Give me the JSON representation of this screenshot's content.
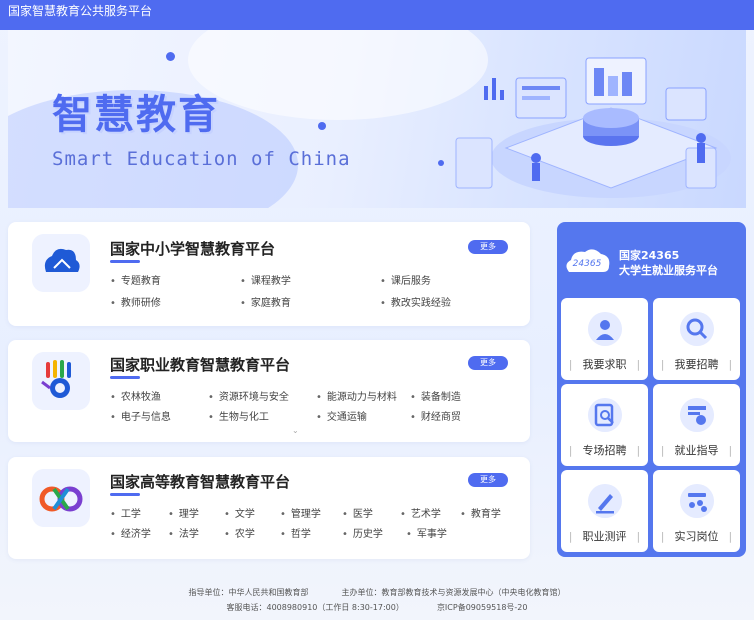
{
  "header": {
    "site_title": "国家智慧教育公共服务平台"
  },
  "banner": {
    "title": "智慧教育",
    "subtitle": "Smart Education of China"
  },
  "platforms": [
    {
      "title": "国家中小学智慧教育平台",
      "more": "更多",
      "items": [
        "专题教育",
        "课程教学",
        "课后服务",
        "教师研修",
        "家庭教育",
        "教改实践经验"
      ]
    },
    {
      "title": "国家职业教育智慧教育平台",
      "more": "更多",
      "items": [
        "农林牧渔",
        "资源环境与安全",
        "能源动力与材料",
        "装备制造",
        "电子与信息",
        "生物与化工",
        "交通运输",
        "财经商贸"
      ]
    },
    {
      "title": "国家高等教育智慧教育平台",
      "more": "更多",
      "items": [
        "工学",
        "理学",
        "文学",
        "管理学",
        "医学",
        "艺术学",
        "教育学",
        "经济学",
        "法学",
        "农学",
        "哲学",
        "历史学",
        "军事学"
      ]
    }
  ],
  "jobs": {
    "badge": "24365",
    "title_line1": "国家24365",
    "title_line2": "大学生就业服务平台",
    "tiles": [
      {
        "label": "我要求职",
        "icon": "job-seeker-icon"
      },
      {
        "label": "我要招聘",
        "icon": "recruit-search-icon"
      },
      {
        "label": "专场招聘",
        "icon": "special-recruit-icon"
      },
      {
        "label": "就业指导",
        "icon": "career-guide-icon"
      },
      {
        "label": "职业测评",
        "icon": "assessment-pen-icon"
      },
      {
        "label": "实习岗位",
        "icon": "internship-icon"
      }
    ]
  },
  "footer": {
    "guide_unit": "指导单位：中华人民共和国教育部",
    "host_unit": "主办单位：教育部教育技术与资源发展中心（中央电化教育馆）",
    "hotline": "客服电话：4008980910（工作日 8:30-17:00）",
    "icp": "京ICP备09059518号-20"
  },
  "colors": {
    "brand": "#4f6bf0",
    "job_panel": "#5577ee"
  }
}
